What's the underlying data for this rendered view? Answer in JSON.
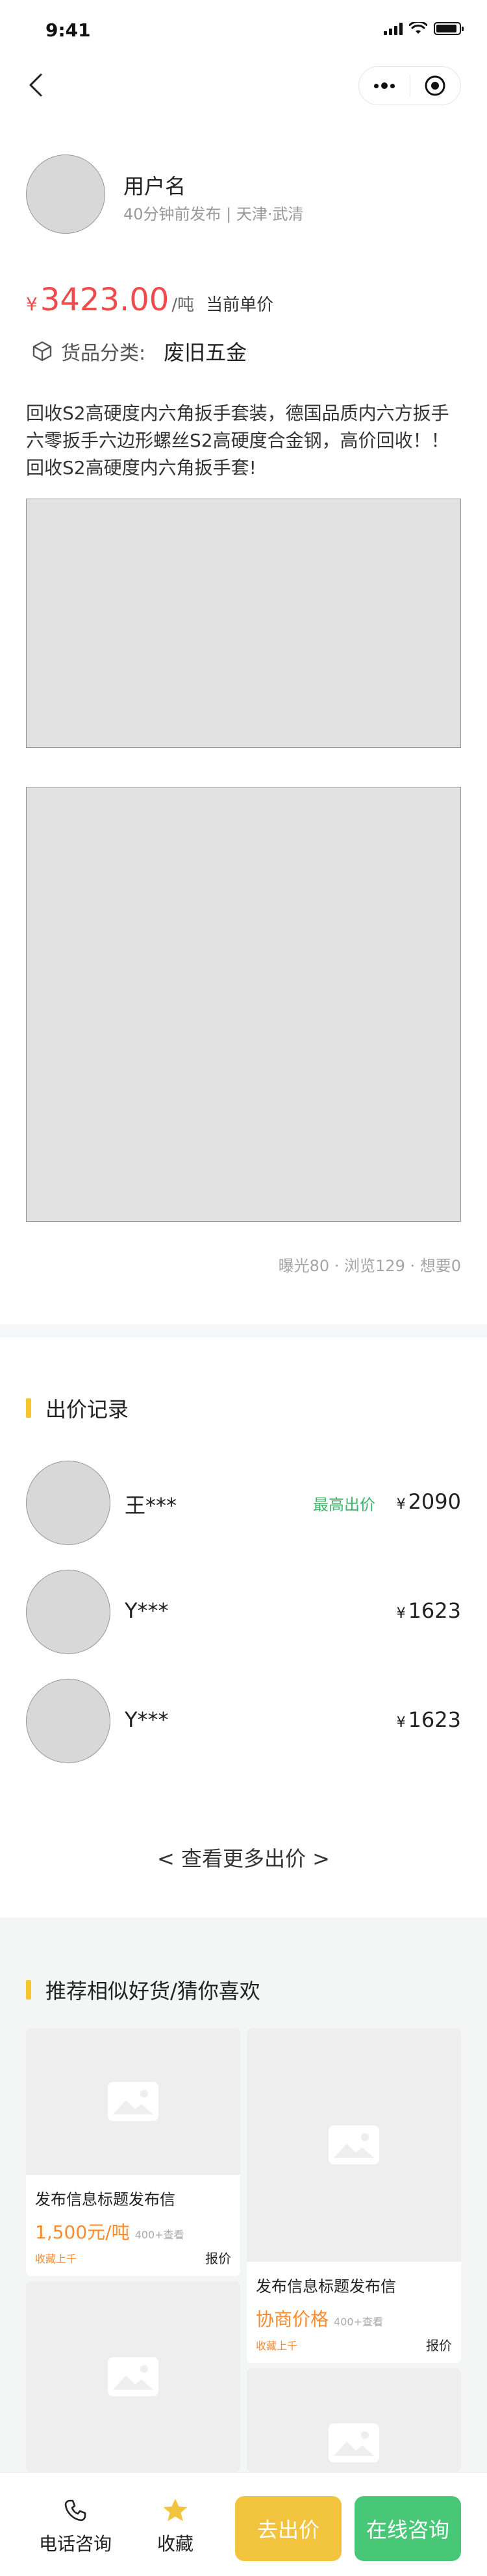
{
  "status_bar": {
    "time": "9:41",
    "battery_level": 0.9
  },
  "nav": {
    "back_icon": "chevron-left-icon",
    "more_icon": "more-dots-icon",
    "close_icon": "target-circle-icon"
  },
  "user": {
    "name": "用户名",
    "meta": "40分钟前发布 | 天津·武清"
  },
  "price": {
    "symbol": "¥",
    "value": "3423.00",
    "unit": "/吨",
    "note": "当前单价"
  },
  "category": {
    "label": "货品分类:",
    "value": "废旧五金"
  },
  "description": "回收S2高硬度内六角扳手套装，德国品质内六方扳手六零扳手六边形螺丝S2高硬度合金钢，高价回收！！回收S2高硬度内六角扳手套!",
  "stats": "曝光80 · 浏览129 · 想要0",
  "bids_section": {
    "title": "出价记录",
    "rows": [
      {
        "name": "王***",
        "tag": "最高出价",
        "symbol": "¥",
        "price": "2090"
      },
      {
        "name": "Y***",
        "tag": "",
        "symbol": "¥",
        "price": "1623"
      },
      {
        "name": "Y***",
        "tag": "",
        "symbol": "¥",
        "price": "1623"
      }
    ],
    "more": "< 查看更多出价 >"
  },
  "recommend": {
    "title": "推荐相似好货/猜你喜欢",
    "cards": [
      {
        "title": "发布信息标题发布信",
        "price": "1,500元/吨",
        "views": "400+查看",
        "fav": "收藏上千",
        "quote": "报价"
      },
      {
        "title": "发布信息标题发布信",
        "price": "协商价格",
        "views": "400+查看",
        "fav": "收藏上千",
        "quote": "报价"
      }
    ]
  },
  "bottom_bar": {
    "phone_label": "电话咨询",
    "fav_label": "收藏",
    "bid_label": "去出价",
    "chat_label": "在线咨询"
  },
  "colors": {
    "price_red": "#f04a4a",
    "accent_yellow": "#f2c43d",
    "accent_green": "#48c777",
    "tag_green": "#3cb868",
    "card_orange": "#ff8a2a"
  }
}
